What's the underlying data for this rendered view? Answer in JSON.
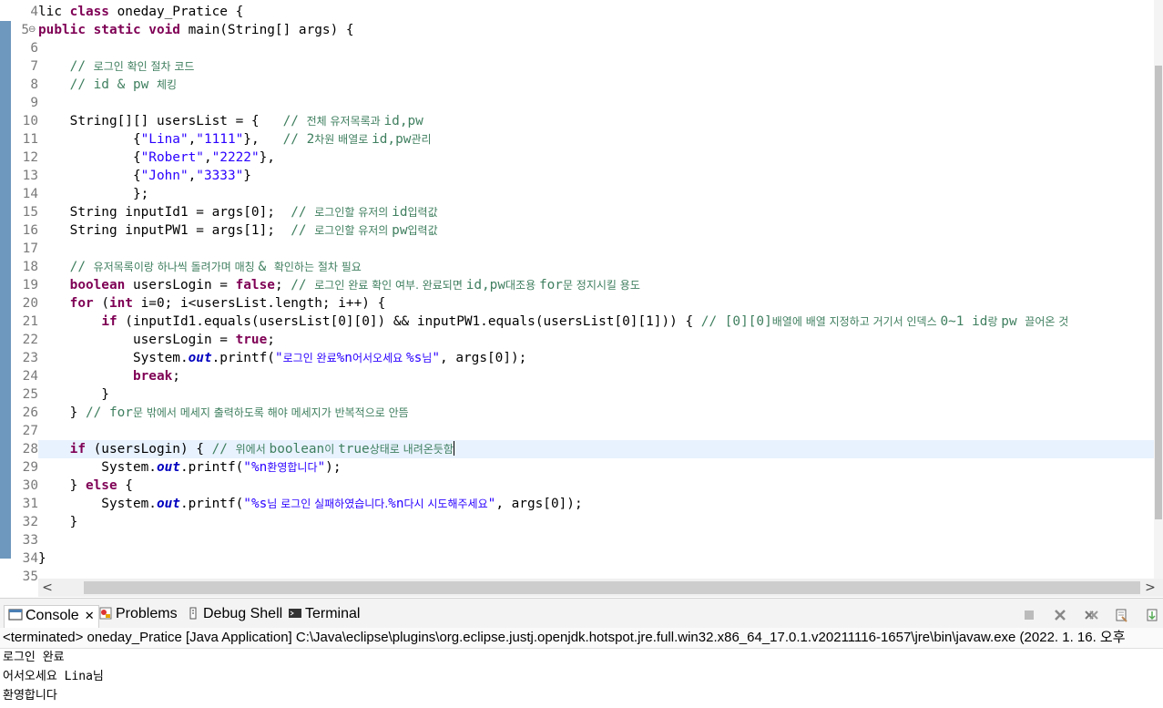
{
  "editor": {
    "lines": [
      {
        "n": "4",
        "segs": [
          [
            "",
            "lic "
          ],
          [
            "kw",
            "class"
          ],
          [
            "",
            " oneday_Pratice {"
          ]
        ]
      },
      {
        "n": "5",
        "mark": "⊖",
        "segs": [
          [
            "kw",
            "public static void"
          ],
          [
            "",
            " main(String[] args) {"
          ]
        ]
      },
      {
        "n": "6",
        "segs": []
      },
      {
        "n": "7",
        "segs": [
          [
            "",
            "    "
          ],
          [
            "cmt",
            "// "
          ],
          [
            "cmt ko",
            "로그인 확인 절차 코드"
          ]
        ]
      },
      {
        "n": "8",
        "segs": [
          [
            "",
            "    "
          ],
          [
            "cmt",
            "// id & pw "
          ],
          [
            "cmt ko",
            "체킹"
          ]
        ]
      },
      {
        "n": "9",
        "segs": []
      },
      {
        "n": "10",
        "segs": [
          [
            "",
            "    String[][] usersList = {   "
          ],
          [
            "cmt",
            "// "
          ],
          [
            "cmt ko",
            "전체 유저목록과 "
          ],
          [
            "cmt",
            "id,pw"
          ]
        ]
      },
      {
        "n": "11",
        "segs": [
          [
            "",
            "            {"
          ],
          [
            "str",
            "\"Lina\""
          ],
          [
            "",
            ","
          ],
          [
            "str",
            "\"1111\""
          ],
          [
            "",
            "},   "
          ],
          [
            "cmt",
            "// 2"
          ],
          [
            "cmt ko",
            "차원 배열로 "
          ],
          [
            "cmt",
            "id,pw"
          ],
          [
            "cmt ko",
            "관리"
          ]
        ]
      },
      {
        "n": "12",
        "segs": [
          [
            "",
            "            {"
          ],
          [
            "str",
            "\"Robert\""
          ],
          [
            "",
            ","
          ],
          [
            "str",
            "\"2222\""
          ],
          [
            "",
            "},"
          ]
        ]
      },
      {
        "n": "13",
        "segs": [
          [
            "",
            "            {"
          ],
          [
            "str",
            "\"John\""
          ],
          [
            "",
            ","
          ],
          [
            "str",
            "\"3333\""
          ],
          [
            "",
            "}"
          ]
        ]
      },
      {
        "n": "14",
        "segs": [
          [
            "",
            "            };"
          ]
        ]
      },
      {
        "n": "15",
        "segs": [
          [
            "",
            "    String inputId1 = args[0];  "
          ],
          [
            "cmt",
            "// "
          ],
          [
            "cmt ko",
            "로그인할 유저의 "
          ],
          [
            "cmt",
            "id"
          ],
          [
            "cmt ko",
            "입력값"
          ]
        ]
      },
      {
        "n": "16",
        "segs": [
          [
            "",
            "    String inputPW1 = args[1];  "
          ],
          [
            "cmt",
            "// "
          ],
          [
            "cmt ko",
            "로그인할 유저의 "
          ],
          [
            "cmt",
            "pw"
          ],
          [
            "cmt ko",
            "입력값"
          ]
        ]
      },
      {
        "n": "17",
        "segs": []
      },
      {
        "n": "18",
        "segs": [
          [
            "",
            "    "
          ],
          [
            "cmt",
            "// "
          ],
          [
            "cmt ko",
            "유저목록이랑 하나씩 돌려가며 매칭 "
          ],
          [
            "cmt",
            "& "
          ],
          [
            "cmt ko",
            "확인하는 절차 필요"
          ]
        ]
      },
      {
        "n": "19",
        "segs": [
          [
            "",
            "    "
          ],
          [
            "kw",
            "boolean"
          ],
          [
            "",
            " usersLogin = "
          ],
          [
            "kw",
            "false"
          ],
          [
            "",
            "; "
          ],
          [
            "cmt",
            "// "
          ],
          [
            "cmt ko",
            "로그인 완료 확인 여부. 완료되면 "
          ],
          [
            "cmt",
            "id,pw"
          ],
          [
            "cmt ko",
            "대조용 "
          ],
          [
            "cmt",
            "for"
          ],
          [
            "cmt ko",
            "문 정지시킬 용도"
          ]
        ]
      },
      {
        "n": "20",
        "segs": [
          [
            "",
            "    "
          ],
          [
            "kw",
            "for"
          ],
          [
            "",
            " ("
          ],
          [
            "kw",
            "int"
          ],
          [
            "",
            " i=0; i<usersList.length; i++) {"
          ]
        ]
      },
      {
        "n": "21",
        "segs": [
          [
            "",
            "        "
          ],
          [
            "kw",
            "if"
          ],
          [
            "",
            " (inputId1.equals(usersList[0][0]) && inputPW1.equals(usersList[0][1])) { "
          ],
          [
            "cmt",
            "// [0][0]"
          ],
          [
            "cmt ko",
            "배열에 배열 지정하고 거기서 인덱스 "
          ],
          [
            "cmt",
            "0~1 id"
          ],
          [
            "cmt ko",
            "랑 "
          ],
          [
            "cmt",
            "pw "
          ],
          [
            "cmt ko",
            "끌어온 것"
          ]
        ]
      },
      {
        "n": "22",
        "segs": [
          [
            "",
            "            usersLogin = "
          ],
          [
            "kw",
            "true"
          ],
          [
            "",
            ";"
          ]
        ]
      },
      {
        "n": "23",
        "segs": [
          [
            "",
            "            System."
          ],
          [
            "fld",
            "out"
          ],
          [
            "",
            ".printf("
          ],
          [
            "str",
            "\""
          ],
          [
            "str ko",
            "로그인 완료"
          ],
          [
            "str",
            "%n"
          ],
          [
            "str ko",
            "어서오세요 "
          ],
          [
            "str",
            "%s"
          ],
          [
            "str ko",
            "님"
          ],
          [
            "str",
            "\""
          ],
          [
            "",
            ", args[0]);"
          ]
        ]
      },
      {
        "n": "24",
        "segs": [
          [
            "",
            "            "
          ],
          [
            "kw",
            "break"
          ],
          [
            "",
            ";"
          ]
        ]
      },
      {
        "n": "25",
        "segs": [
          [
            "",
            "        }"
          ]
        ]
      },
      {
        "n": "26",
        "segs": [
          [
            "",
            "    } "
          ],
          [
            "cmt",
            "// for"
          ],
          [
            "cmt ko",
            "문 밖에서 메세지 출력하도록 해야 메세지가 반복적으로 안뜸"
          ]
        ]
      },
      {
        "n": "27",
        "segs": []
      },
      {
        "n": "28",
        "current": true,
        "segs": [
          [
            "",
            "    "
          ],
          [
            "kw",
            "if"
          ],
          [
            "",
            " (usersLogin) { "
          ],
          [
            "cmt",
            "// "
          ],
          [
            "cmt ko",
            "위에서 "
          ],
          [
            "cmt",
            "boolean"
          ],
          [
            "cmt ko",
            "이 "
          ],
          [
            "cmt",
            "true"
          ],
          [
            "cmt ko",
            "상태로 내려온듯함"
          ]
        ]
      },
      {
        "n": "29",
        "segs": [
          [
            "",
            "        System."
          ],
          [
            "fld",
            "out"
          ],
          [
            "",
            ".printf("
          ],
          [
            "str",
            "\"%n"
          ],
          [
            "str ko",
            "환영합니다"
          ],
          [
            "str",
            "\""
          ],
          [
            "",
            ");"
          ]
        ]
      },
      {
        "n": "30",
        "segs": [
          [
            "",
            "    } "
          ],
          [
            "kw",
            "else"
          ],
          [
            "",
            " {"
          ]
        ]
      },
      {
        "n": "31",
        "segs": [
          [
            "",
            "        System."
          ],
          [
            "fld",
            "out"
          ],
          [
            "",
            ".printf("
          ],
          [
            "str",
            "\"%s"
          ],
          [
            "str ko",
            "님 로그인 실패하였습니다."
          ],
          [
            "str",
            "%n"
          ],
          [
            "str ko",
            "다시 시도해주세요"
          ],
          [
            "str",
            "\""
          ],
          [
            "",
            ", args[0]);"
          ]
        ]
      },
      {
        "n": "32",
        "segs": [
          [
            "",
            "    }"
          ]
        ]
      },
      {
        "n": "33",
        "segs": []
      },
      {
        "n": "34",
        "segs": [
          [
            "",
            "}"
          ]
        ]
      },
      {
        "n": "35",
        "segs": []
      }
    ]
  },
  "scroll": {
    "left_arrow": "<",
    "right_arrow": ">"
  },
  "console": {
    "tabs": [
      {
        "id": "console",
        "label": "Console",
        "close": "✕"
      },
      {
        "id": "problems",
        "label": "Problems"
      },
      {
        "id": "debug-shell",
        "label": "Debug Shell"
      },
      {
        "id": "terminal",
        "label": "Terminal"
      }
    ],
    "status": "<terminated> oneday_Pratice [Java Application] C:\\Java\\eclipse\\plugins\\org.eclipse.justj.openjdk.hotspot.jre.full.win32.x86_64_17.0.1.v20211116-1657\\jre\\bin\\javaw.exe  (2022. 1. 16. 오후",
    "output": [
      "로그인 완료",
      "어서오세요 Lina님",
      "환영합니다"
    ]
  }
}
